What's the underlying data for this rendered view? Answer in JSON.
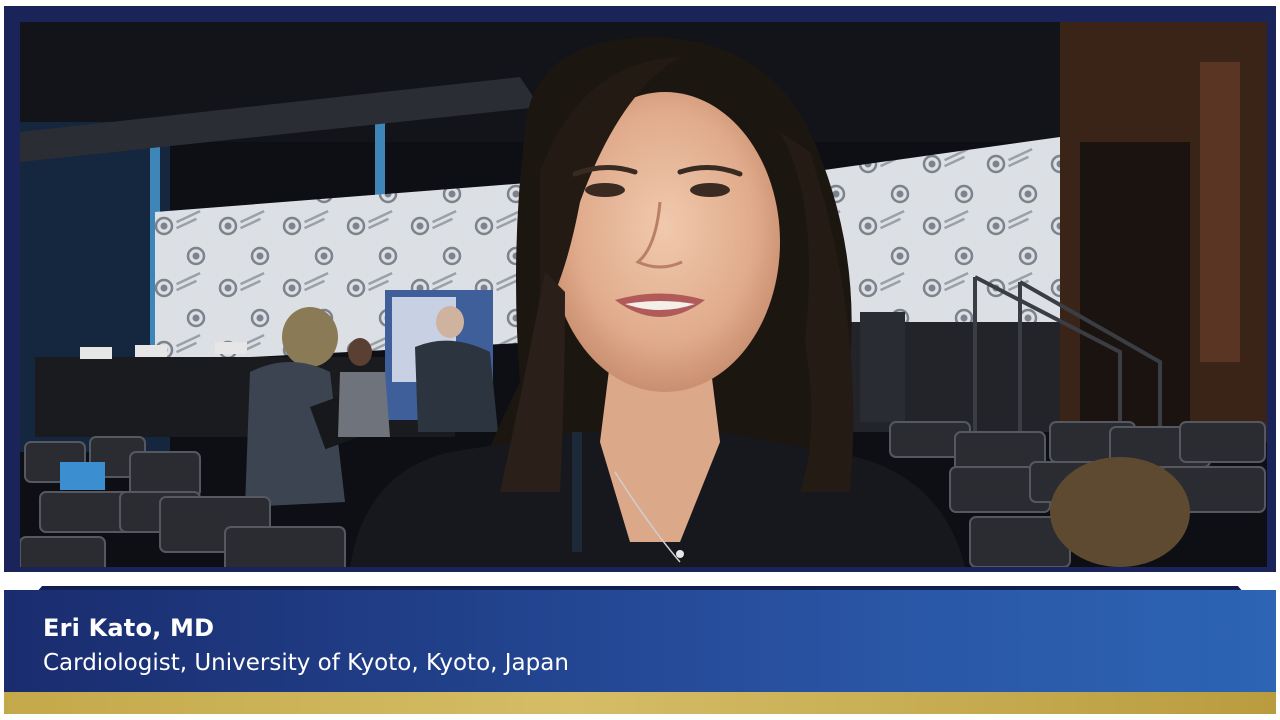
{
  "speaker": {
    "name": "Eri Kato, MD",
    "title": "Cardiologist, University of Kyoto, Kyoto, Japan"
  },
  "colors": {
    "border_navy": "#1b2458",
    "lower_third_blue": "#21408a",
    "gold_bar": "#c9ae50",
    "text": "#ffffff"
  },
  "icons": [
    "acc-logo-pattern"
  ]
}
